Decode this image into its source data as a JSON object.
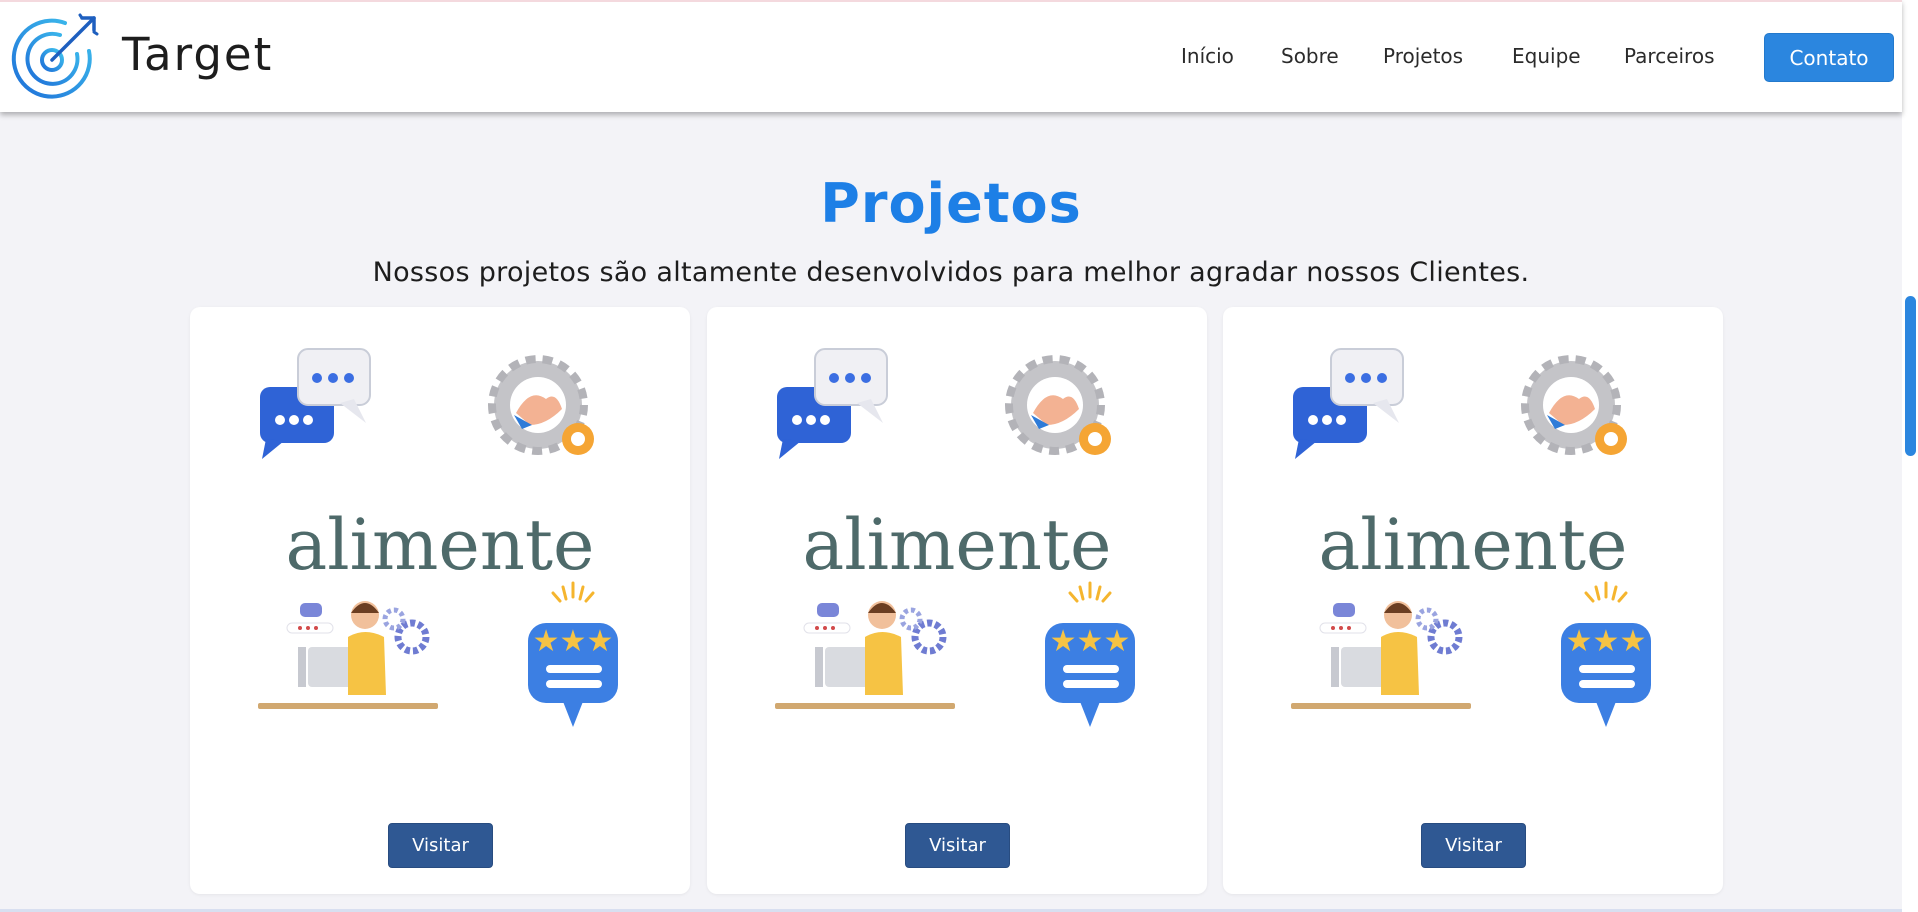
{
  "header": {
    "brand": "Target",
    "nav": [
      "Início",
      "Sobre",
      "Projetos",
      "Equipe",
      "Parceiros"
    ],
    "contact_label": "Contato"
  },
  "section": {
    "title": "Projetos",
    "subtitle": "Nossos projetos são altamente desenvolvidos para melhor agradar nossos Clientes."
  },
  "cards": [
    {
      "logo_text": "alimente",
      "button_label": "Visitar"
    },
    {
      "logo_text": "alimente",
      "button_label": "Visitar"
    },
    {
      "logo_text": "alimente",
      "button_label": "Visitar"
    }
  ],
  "icons": {
    "logo": "target-logo-icon",
    "chat": "chat-bubbles-icon",
    "partnership": "handshake-gear-icon",
    "support": "support-agent-icon",
    "rating": "star-rating-icon"
  },
  "colors": {
    "accent": "#2b86df",
    "title": "#1d7fe6",
    "visit_button": "#2f5893",
    "logo_text": "#4e6a6a"
  }
}
